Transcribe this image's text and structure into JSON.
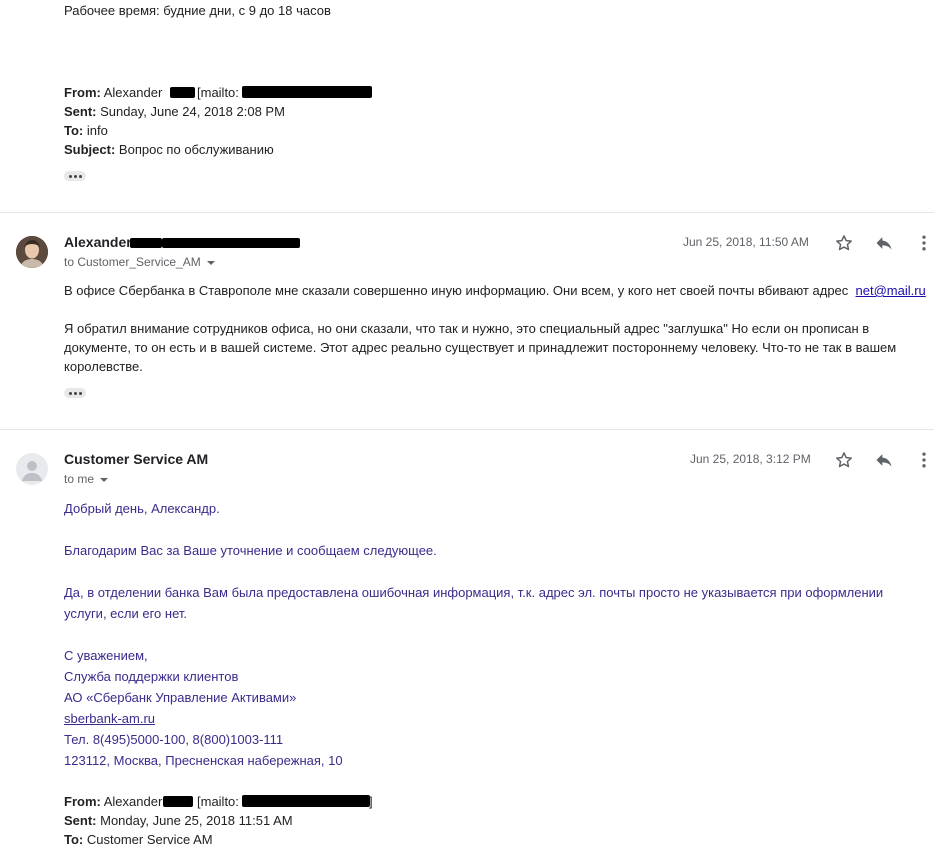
{
  "top": {
    "work_hours": "Рабочее время: будние дни, с 9 до 18 часов",
    "quoted": {
      "from_label": "From:",
      "from_value": "Alexander",
      "mailto_label": "[mailto:",
      "sent_label": "Sent:",
      "sent_value": "Sunday, June 24, 2018 2:08 PM",
      "to_label": "To:",
      "to_value": "info",
      "subject_label": "Subject:",
      "subject_value": "Вопрос по обслуживанию"
    }
  },
  "message1": {
    "sender": "Alexander",
    "to_line": "to Customer_Service_AM",
    "date": "Jun 25, 2018, 11:50 AM",
    "body_p1": "В офисе Сбербанка в Ставрополе мне сказали совершенно иную информацию. Они всем, у кого нет своей почты вбивают адрес",
    "body_link": "net@mail.ru",
    "body_p2": "Я обратил внимание сотрудников офиса, но они сказали, что так и нужно, это специальный адрес \"заглушка\" Но если он прописан в документе, то он есть и в вашей системе. Этот адрес реально существует и принадлежит постороннему человеку. Что-то не так в вашем королевстве."
  },
  "message2": {
    "sender": "Customer Service AM",
    "to_line": "to me",
    "date": "Jun 25, 2018, 3:12 PM",
    "greeting": "Добрый день, Александр.",
    "thanks": "Благодарим Вас за Ваше уточнение и сообщаем следующее.",
    "answer": "Да, в отделении банка Вам была предоставлена ошибочная информация, т.к. адрес эл. почты просто не указывается при оформлении услуги, если его нет.",
    "sig_regards": "С уважением,",
    "sig_dept": "Служба поддержки клиентов",
    "sig_company": "АО «Сбербанк Управление Активами»",
    "sig_site": "sberbank-am.ru",
    "sig_phone": "Тел. 8(495)5000-100, 8(800)1003-111",
    "sig_address": "123112, Москва, Пресненская набережная, 10",
    "quoted": {
      "from_label": "From:",
      "from_value": "Alexander",
      "mailto_label": "[mailto:",
      "mailto_close": "]",
      "sent_label": "Sent:",
      "sent_value": "Monday, June 25, 2018 11:51 AM",
      "to_label": "To:",
      "to_value": "Customer Service AM"
    }
  },
  "icons": {
    "star": "star-icon",
    "reply": "reply-icon",
    "more": "more-vert-icon",
    "avatar_default": "person-icon"
  }
}
